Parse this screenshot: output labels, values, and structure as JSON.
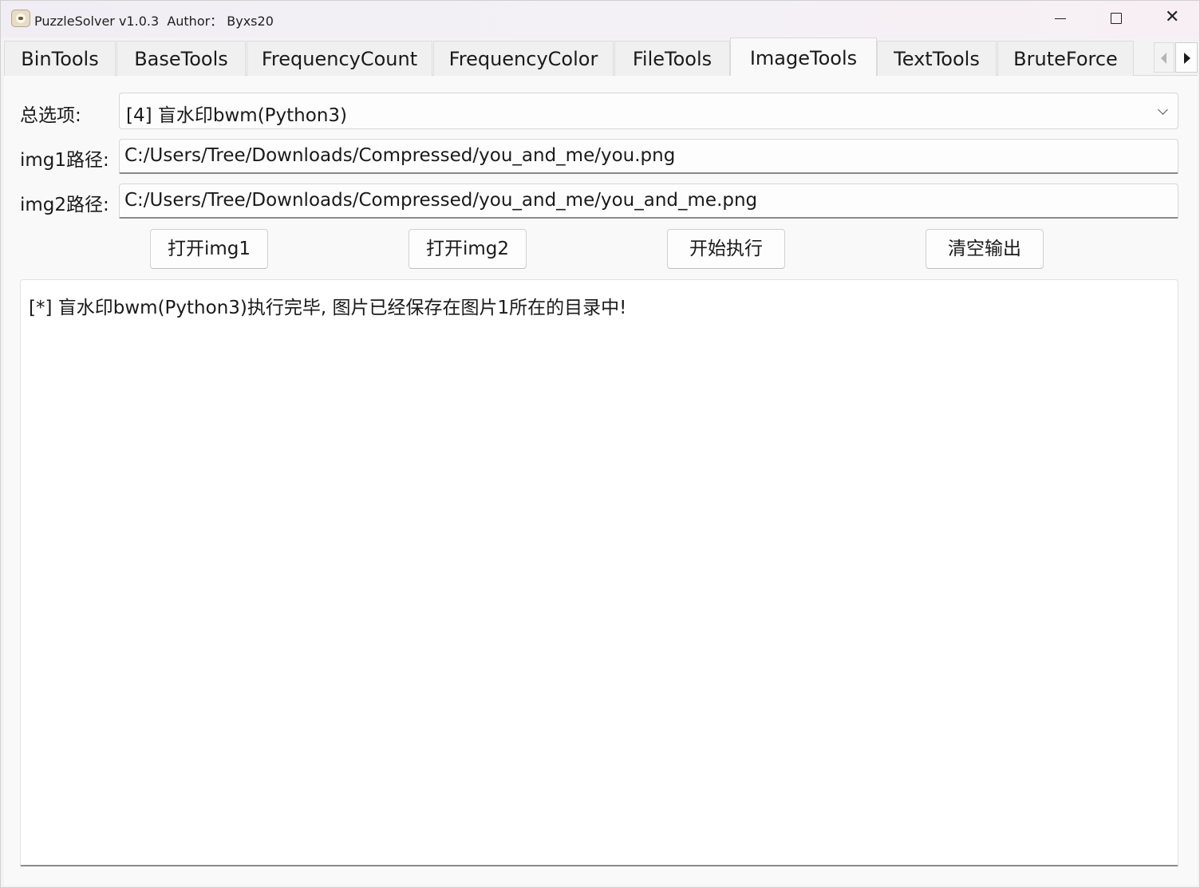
{
  "window": {
    "title": "PuzzleSolver v1.0.3  Author： Byxs20",
    "icon": "alpaca-app-icon",
    "controls": {
      "minimize": "minimize-icon",
      "maximize": "maximize-icon",
      "close": "close-icon"
    }
  },
  "tabs": [
    {
      "label": "BinTools",
      "active": false
    },
    {
      "label": "BaseTools",
      "active": false
    },
    {
      "label": "FrequencyCount",
      "active": false
    },
    {
      "label": "FrequencyColor",
      "active": false
    },
    {
      "label": "FileTools",
      "active": false
    },
    {
      "label": "ImageTools",
      "active": true
    },
    {
      "label": "TextTools",
      "active": false
    },
    {
      "label": "BruteForce",
      "active": false
    }
  ],
  "form": {
    "option_label": "总选项:",
    "option_value": "[4] 盲水印bwm(Python3)",
    "img1_label": "img1路径:",
    "img1_value": "C:/Users/Tree/Downloads/Compressed/you_and_me/you.png",
    "img2_label": "img2路径:",
    "img2_value": "C:/Users/Tree/Downloads/Compressed/you_and_me/you_and_me.png"
  },
  "buttons": {
    "open_img1": "打开img1",
    "open_img2": "打开img2",
    "execute": "开始执行",
    "clear_output": "清空输出"
  },
  "output": {
    "text": "[*] 盲水印bwm(Python3)执行完毕, 图片已经保存在图片1所在的目录中!"
  }
}
